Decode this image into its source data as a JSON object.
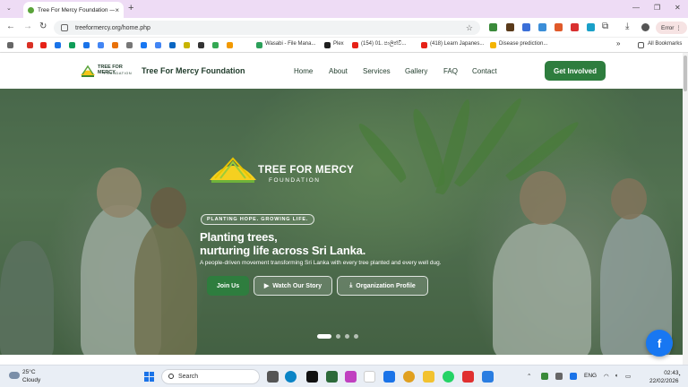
{
  "browser": {
    "tab_title": "Tree For Mercy Foundation — T…",
    "url": "treeformercy.org/home.php",
    "error_label": "Error",
    "bookmarks": [
      {
        "label": "Wasabi - File Mana..."
      },
      {
        "label": "Plex"
      },
      {
        "label": "(154) 01. පාලිත්වි..."
      },
      {
        "label": "(418) Learn Japanes..."
      },
      {
        "label": "Disease prediction..."
      }
    ],
    "all_bookmarks_label": "All Bookmarks"
  },
  "site": {
    "logo_text": "TREE FOR MERCY",
    "logo_subtext": "FOUNDATION",
    "brand": "Tree For Mercy Foundation",
    "nav": [
      "Home",
      "About",
      "Services",
      "Gallery",
      "FAQ",
      "Contact"
    ],
    "cta": "Get Involved"
  },
  "hero": {
    "logo_name": "TREE FOR MERCY",
    "logo_sub": "FOUNDATION",
    "pill": "PLANTING HOPE. GROWING LIFE.",
    "headline_line1": "Planting trees,",
    "headline_line2": "nurturing life across Sri Lanka.",
    "tagline": "A people-driven movement transforming Sri Lanka with every tree planted and every well dug.",
    "buttons": {
      "join": "Join Us",
      "watch": "Watch Our Story",
      "profile": "Organization Profile"
    },
    "slides_total": 4,
    "active_slide": 1
  },
  "taskbar": {
    "temperature": "25°C",
    "weather": "Cloudy",
    "search_placeholder": "Search",
    "language": "ENG",
    "time": "02:43",
    "date": "22/02/2026"
  },
  "colors": {
    "brand_green": "#2e7d3e",
    "facebook_blue": "#1877f2"
  }
}
